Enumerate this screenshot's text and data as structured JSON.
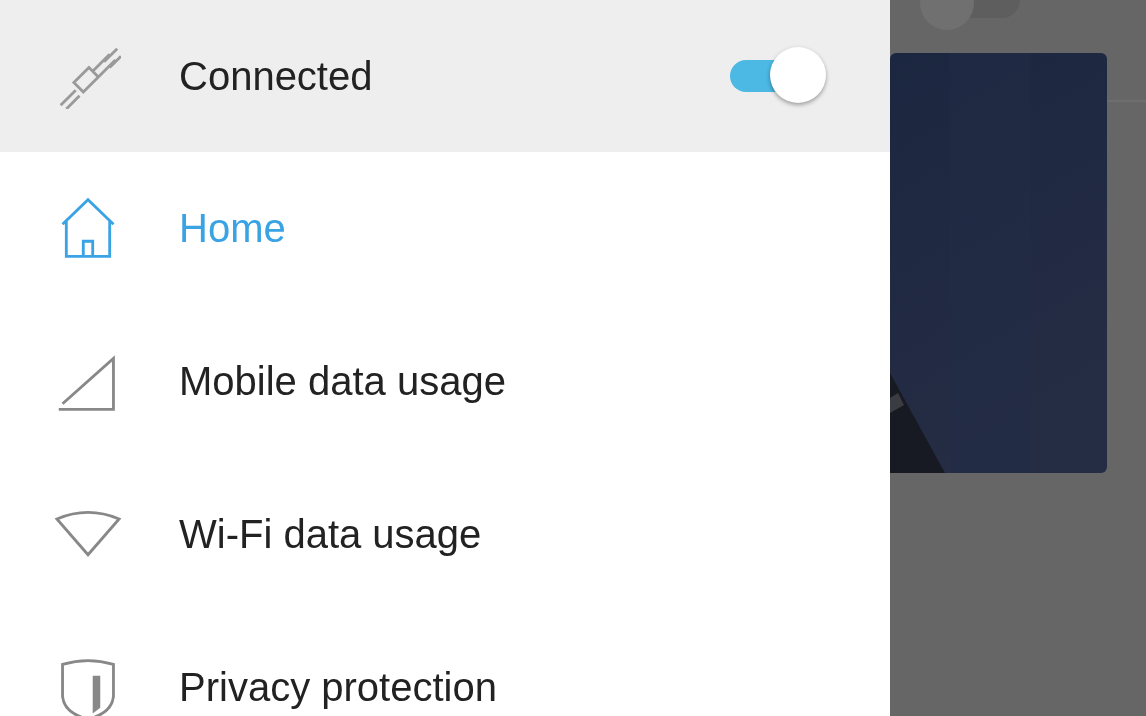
{
  "background_switch": {
    "on": false
  },
  "connection": {
    "label": "Connected",
    "on": true
  },
  "menu": [
    {
      "kind": "home",
      "label": "Home",
      "selected": true
    },
    {
      "kind": "mobile",
      "label": "Mobile data usage",
      "selected": false
    },
    {
      "kind": "wifi",
      "label": "Wi-Fi data usage",
      "selected": false
    },
    {
      "kind": "privacy",
      "label": "Privacy protection",
      "selected": false
    }
  ]
}
